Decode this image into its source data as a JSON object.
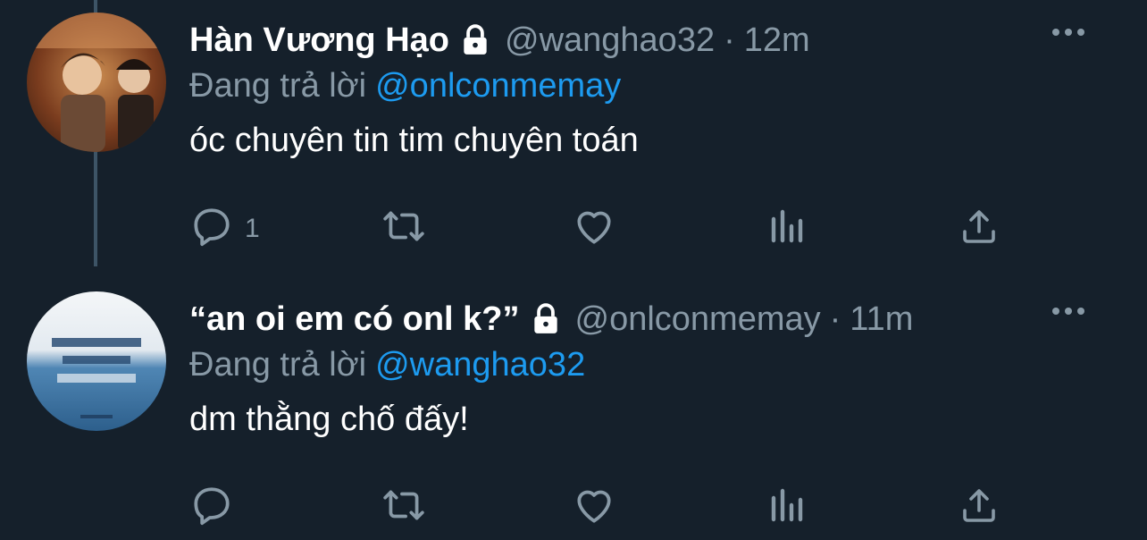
{
  "tweets": [
    {
      "display_name": "Hàn Vương Hạo",
      "handle": "@wanghao32",
      "separator": "·",
      "time": "12m",
      "reply_prefix": "Đang trả lời",
      "reply_to": "@onlconmemay",
      "text": "óc chuyên tin tim chuyên toán",
      "reply_count": "1"
    },
    {
      "display_name": "“an oi em có onl k?”",
      "handle": "@onlconmemay",
      "separator": "·",
      "time": "11m",
      "reply_prefix": "Đang trả lời",
      "reply_to": "@wanghao32",
      "text": "dm thằng chố đấy!",
      "reply_count": ""
    }
  ],
  "icons": [
    "lock-icon",
    "more-icon",
    "reply-icon",
    "retweet-icon",
    "like-icon",
    "analytics-icon",
    "share-icon"
  ],
  "colors": {
    "background": "#15202b",
    "text": "#ffffff",
    "muted": "#8899a6",
    "link": "#1d9bf0",
    "thread_line": "#3d5466"
  }
}
